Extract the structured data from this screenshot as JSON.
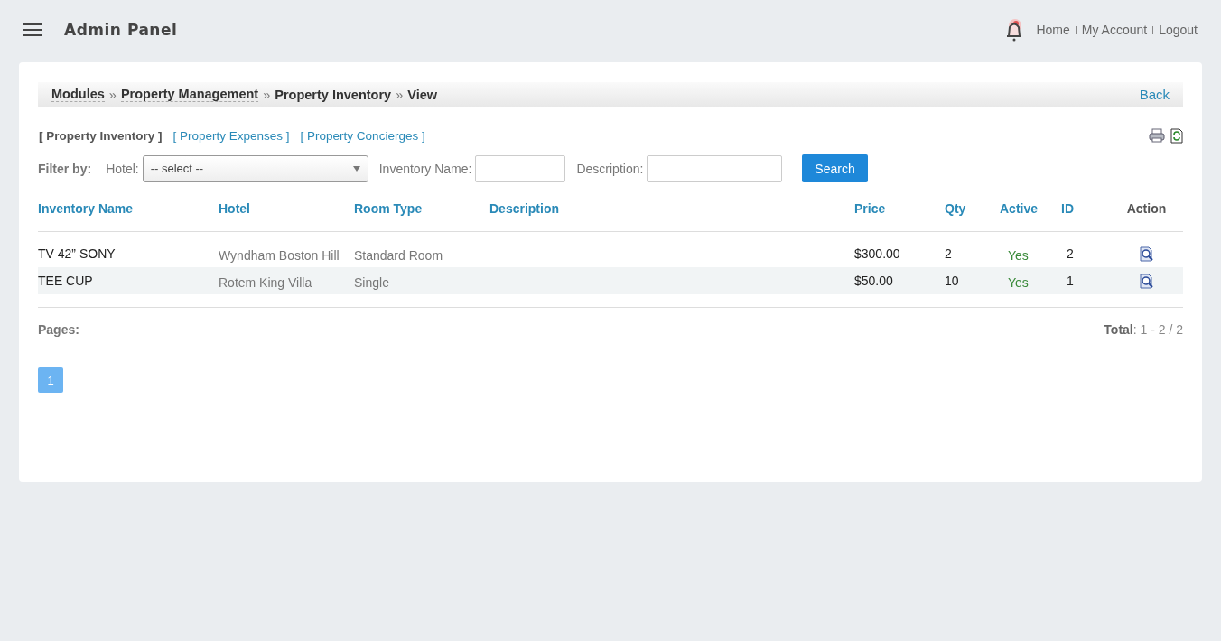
{
  "header": {
    "title": "Admin Panel",
    "links": [
      "Home",
      "My Account",
      "Logout"
    ]
  },
  "breadcrumb": {
    "items": [
      {
        "label": "Modules",
        "link": true
      },
      {
        "label": "Property Management",
        "link": true
      },
      {
        "label": "Property Inventory",
        "link": false
      },
      {
        "label": "View",
        "link": false
      }
    ],
    "separator": "»",
    "back": "Back"
  },
  "tabs": [
    {
      "label": "[ Property Inventory ]",
      "selected": true
    },
    {
      "label": "[ Property Expenses ]",
      "selected": false
    },
    {
      "label": "[ Property Concierges ]",
      "selected": false
    }
  ],
  "filter": {
    "label": "Filter by:",
    "hotel_label": "Hotel:",
    "hotel_value": "-- select --",
    "name_label": "Inventory Name:",
    "description_label": "Description:",
    "search": "Search"
  },
  "table": {
    "columns": [
      {
        "label": "Inventory Name",
        "sortable": true
      },
      {
        "label": "Hotel",
        "sortable": true
      },
      {
        "label": "Room Type",
        "sortable": true
      },
      {
        "label": "Description",
        "sortable": true
      },
      {
        "label": "Price",
        "sortable": true
      },
      {
        "label": "Qty",
        "sortable": true
      },
      {
        "label": "Active",
        "sortable": true
      },
      {
        "label": "ID",
        "sortable": true
      },
      {
        "label": "Action",
        "sortable": false
      }
    ],
    "rows": [
      {
        "name": "TV 42” SONY",
        "hotel": "Wyndham Boston Hill",
        "room_type": "Standard Room",
        "price": "$300.00",
        "qty": "2",
        "active": "Yes",
        "id": "2"
      },
      {
        "name": "TEE CUP",
        "hotel": "Rotem King Villa",
        "room_type": "Single",
        "price": "$50.00",
        "qty": "10",
        "active": "Yes",
        "id": "1"
      }
    ]
  },
  "pager": {
    "label": "Pages:",
    "total": "**Total**: 1 - 2 / 2",
    "pages": [
      {
        "label": "1",
        "selected": true
      }
    ]
  }
}
